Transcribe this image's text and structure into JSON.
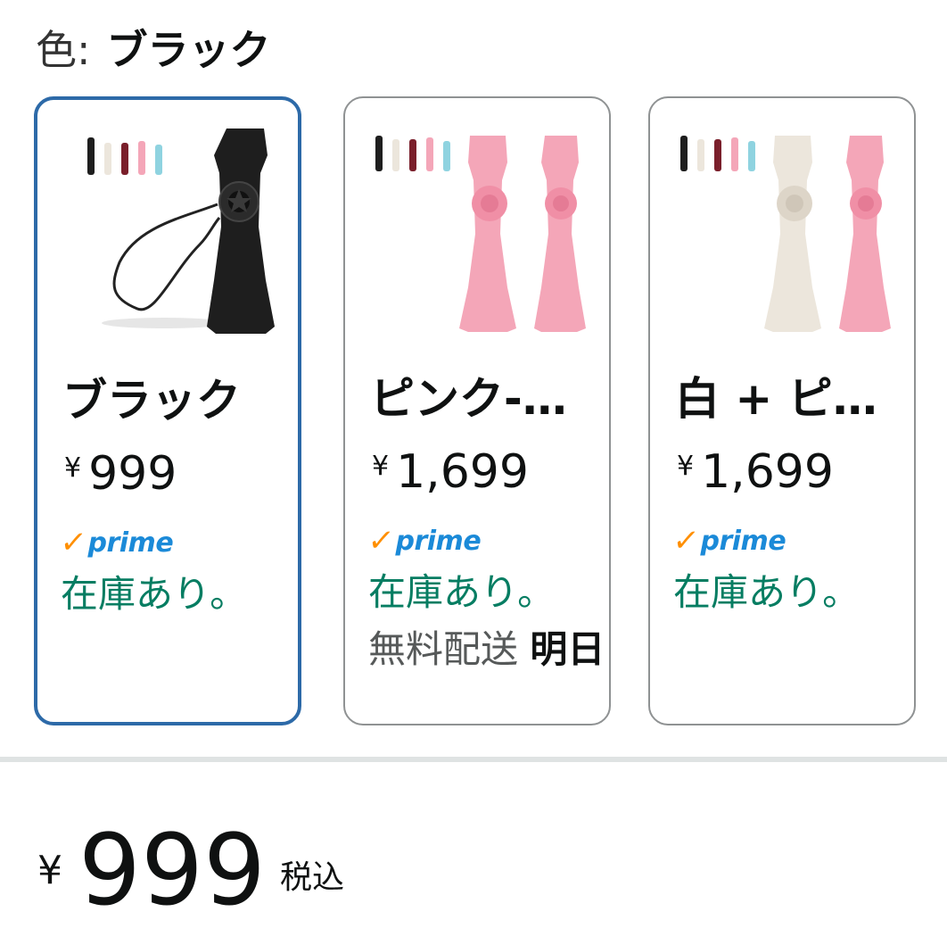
{
  "color_selector": {
    "label": "色:",
    "selected_value": "ブラック"
  },
  "variants": [
    {
      "name": "ブラック",
      "yen": "¥",
      "price": "999",
      "prime_label": "prime",
      "stock": "在庫あり。",
      "shipping": "",
      "shipping_bold": "",
      "image_icon": "black-kazoo-image",
      "selected": true
    },
    {
      "name": "ピンク-…",
      "yen": "¥",
      "price": "1,699",
      "prime_label": "prime",
      "stock": "在庫あり。",
      "shipping": "無料配送",
      "shipping_bold": "明日",
      "image_icon": "pink-kazoo-pair-image",
      "selected": false
    },
    {
      "name": "白 + ピ…",
      "yen": "¥",
      "price": "1,699",
      "prime_label": "prime",
      "stock": "在庫あり。",
      "shipping": "",
      "shipping_bold": "",
      "image_icon": "white-pink-kazoo-pair-image",
      "selected": false
    }
  ],
  "price_summary": {
    "yen": "¥",
    "amount": "999",
    "tax_label": "税込"
  },
  "colors": {
    "selected_border": "#2d6aa8",
    "stock_green": "#067d62",
    "prime_blue": "#1b8ad8",
    "prime_check_orange": "#ff8f00",
    "kazoo_black": "#1e1e1e",
    "kazoo_pink": "#f4a6b8",
    "kazoo_white": "#ece6dc"
  }
}
